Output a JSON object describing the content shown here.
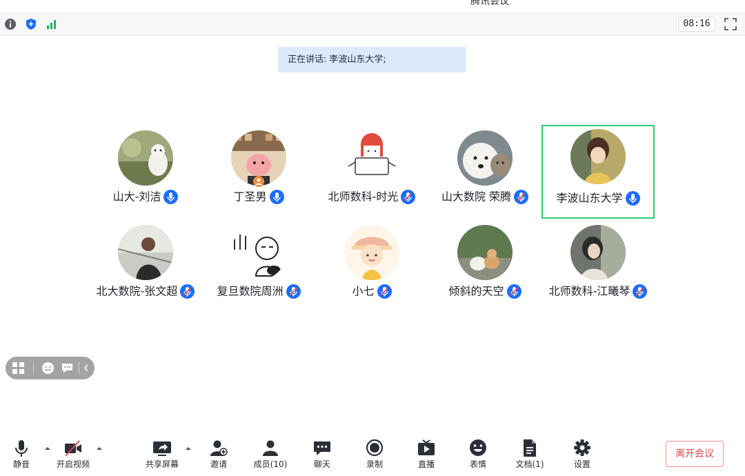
{
  "window": {
    "title": "腾讯会议"
  },
  "status": {
    "time": "08:16"
  },
  "speaking": {
    "label": "正在讲话:",
    "name": "李波山东大学;"
  },
  "participants": [
    {
      "name": "山大-刘洁",
      "mic": "on"
    },
    {
      "name": "丁圣男",
      "mic": "on"
    },
    {
      "name": "北师数科-时光",
      "mic": "muted"
    },
    {
      "name": "山大数院 荣腾",
      "mic": "muted"
    },
    {
      "name": "李波山东大学",
      "mic": "on",
      "active": true
    },
    {
      "name": "北大数院-张文超",
      "mic": "muted"
    },
    {
      "name": "复旦数院周洲",
      "mic": "muted"
    },
    {
      "name": "小七",
      "mic": "muted"
    },
    {
      "name": "倾斜的天空",
      "mic": "muted"
    },
    {
      "name": "北师数科-江曦琴",
      "mic": "muted"
    }
  ],
  "toolbar": {
    "mute": "静音",
    "video": "开启视频",
    "share": "共享屏幕",
    "invite": "邀请",
    "members": "成员(10)",
    "chat": "聊天",
    "record": "录制",
    "live": "直播",
    "emoji": "表情",
    "docs": "文档(1)",
    "settings": "设置",
    "leave": "离开会议"
  },
  "colors": {
    "accent": "#1a6dff",
    "active_border": "#2ecc71",
    "leave": "#e5484d",
    "speaking_bg": "#dbe9fb"
  }
}
